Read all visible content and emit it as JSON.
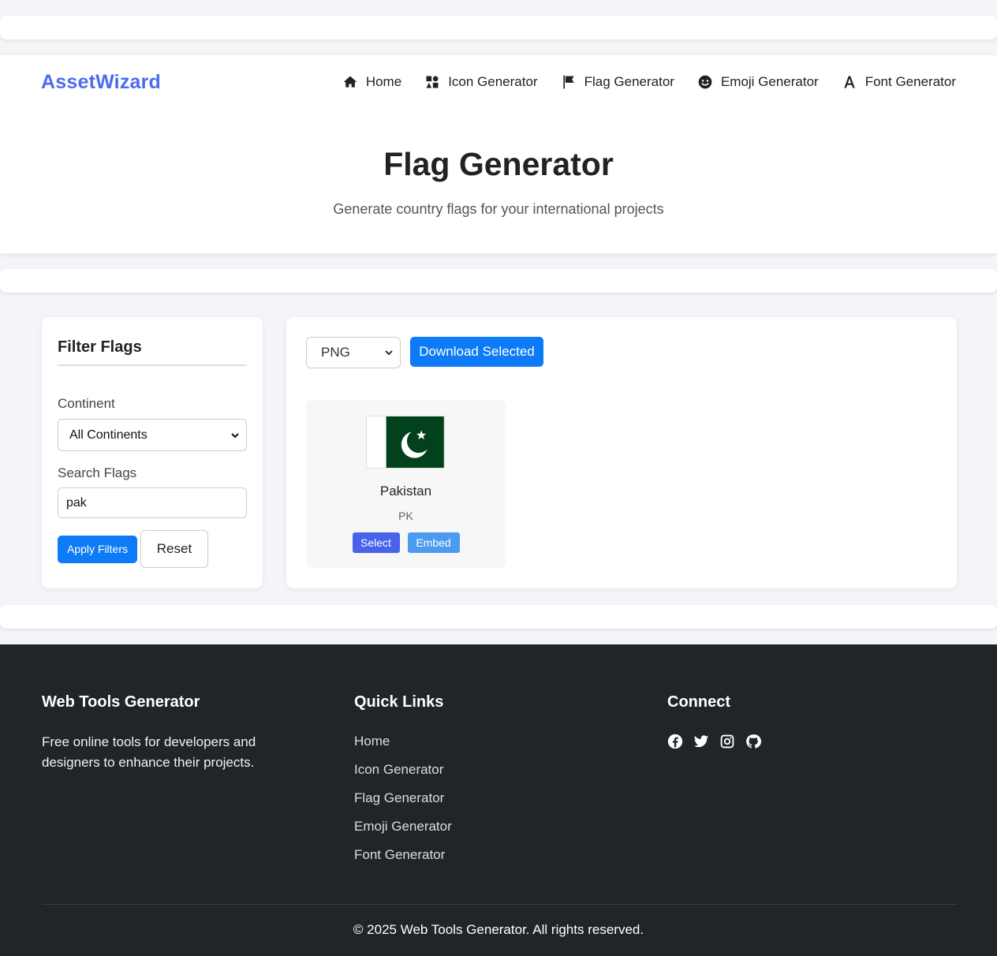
{
  "brand": "AssetWizard",
  "nav": [
    {
      "label": "Home",
      "icon": "home-icon"
    },
    {
      "label": "Icon Generator",
      "icon": "icons-icon"
    },
    {
      "label": "Flag Generator",
      "icon": "flag-icon"
    },
    {
      "label": "Emoji Generator",
      "icon": "smile-icon"
    },
    {
      "label": "Font Generator",
      "icon": "font-icon"
    }
  ],
  "hero": {
    "title": "Flag Generator",
    "subtitle": "Generate country flags for your international projects"
  },
  "filters": {
    "title": "Filter Flags",
    "continent_label": "Continent",
    "continent_value": "All Continents",
    "search_label": "Search Flags",
    "search_value": "pak",
    "apply_label": "Apply Filters",
    "reset_label": "Reset"
  },
  "toolbar": {
    "format_value": "PNG",
    "download_label": "Download Selected"
  },
  "flags": [
    {
      "name": "Pakistan",
      "code": "PK",
      "select_label": "Select",
      "embed_label": "Embed"
    }
  ],
  "footer": {
    "about_title": "Web Tools Generator",
    "about_text": "Free online tools for developers and designers to enhance their projects.",
    "links_title": "Quick Links",
    "links": [
      "Home",
      "Icon Generator",
      "Flag Generator",
      "Emoji Generator",
      "Font Generator"
    ],
    "connect_title": "Connect",
    "social": [
      "facebook-icon",
      "twitter-icon",
      "instagram-icon",
      "github-icon"
    ],
    "copyright": "© 2025 Web Tools Generator. All rights reserved."
  },
  "colors": {
    "brand": "#4a6cf0",
    "primary_button": "#0d7bf7",
    "select_button": "#4962ea",
    "embed_button": "#4b9cf0",
    "footer_bg": "#212429",
    "pakistan_green": "#01411c"
  }
}
